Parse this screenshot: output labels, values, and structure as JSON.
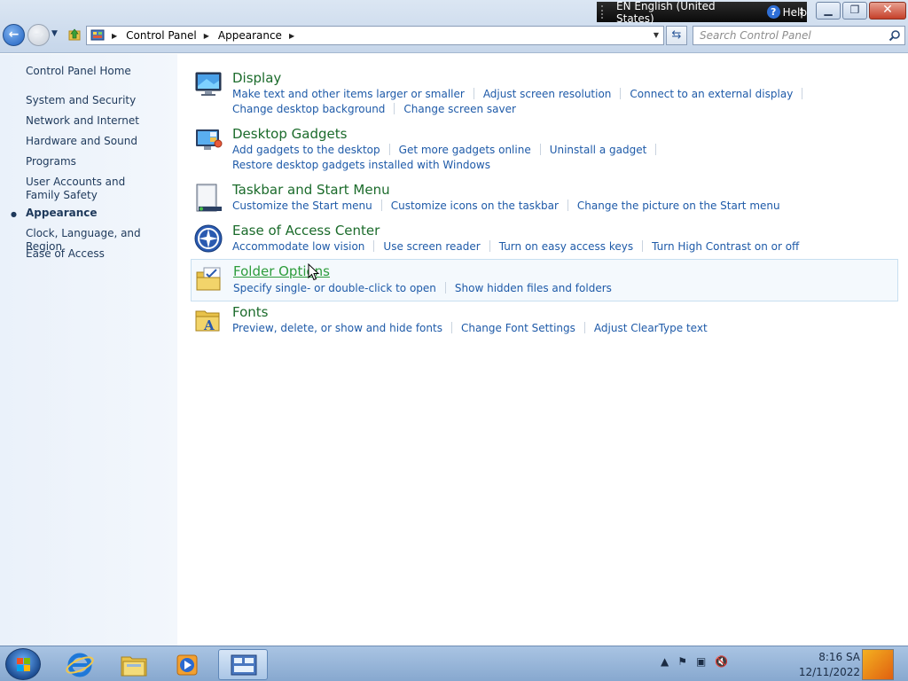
{
  "language_bar": {
    "language": "EN English (United States)",
    "help": "Help"
  },
  "window": {
    "minimize": "▁",
    "maximize": "❐",
    "close": "✕"
  },
  "address_bar": {
    "crumbs": [
      "Control Panel",
      "Appearance"
    ],
    "search_placeholder": "Search Control Panel"
  },
  "sidebar": {
    "home": "Control Panel Home",
    "items": [
      {
        "label": "System and Security"
      },
      {
        "label": "Network and Internet"
      },
      {
        "label": "Hardware and Sound"
      },
      {
        "label": "Programs"
      },
      {
        "label": "User Accounts and Family Safety"
      },
      {
        "label": "Appearance",
        "active": true
      },
      {
        "label": "Clock, Language, and Region"
      },
      {
        "label": "Ease of Access"
      }
    ]
  },
  "categories": [
    {
      "title": "Display",
      "icon": "display-icon",
      "links": [
        "Make text and other items larger or smaller",
        "Adjust screen resolution",
        "Connect to an external display",
        "Change desktop background",
        "Change screen saver"
      ]
    },
    {
      "title": "Desktop Gadgets",
      "icon": "gadgets-icon",
      "links": [
        "Add gadgets to the desktop",
        "Get more gadgets online",
        "Uninstall a gadget",
        "Restore desktop gadgets installed with Windows"
      ]
    },
    {
      "title": "Taskbar and Start Menu",
      "icon": "taskbar-icon",
      "links": [
        "Customize the Start menu",
        "Customize icons on the taskbar",
        "Change the picture on the Start menu"
      ]
    },
    {
      "title": "Ease of Access Center",
      "icon": "ease-of-access-icon",
      "links": [
        "Accommodate low vision",
        "Use screen reader",
        "Turn on easy access keys",
        "Turn High Contrast on or off"
      ]
    },
    {
      "title": "Folder Options",
      "icon": "folder-options-icon",
      "hovered": true,
      "links": [
        "Specify single- or double-click to open",
        "Show hidden files and folders"
      ]
    },
    {
      "title": "Fonts",
      "icon": "fonts-icon",
      "links": [
        "Preview, delete, or show and hide fonts",
        "Change Font Settings",
        "Adjust ClearType text"
      ]
    }
  ],
  "taskbar": {
    "apps": [
      "internet-explorer-icon",
      "windows-explorer-icon",
      "media-player-icon",
      "control-panel-icon"
    ],
    "time": "8:16 SA",
    "date": "12/11/2022"
  },
  "colors": {
    "title_green": "#1b6b2b",
    "link_blue": "#1e5aa8",
    "sidebar_bg": "#eaf1fa"
  }
}
